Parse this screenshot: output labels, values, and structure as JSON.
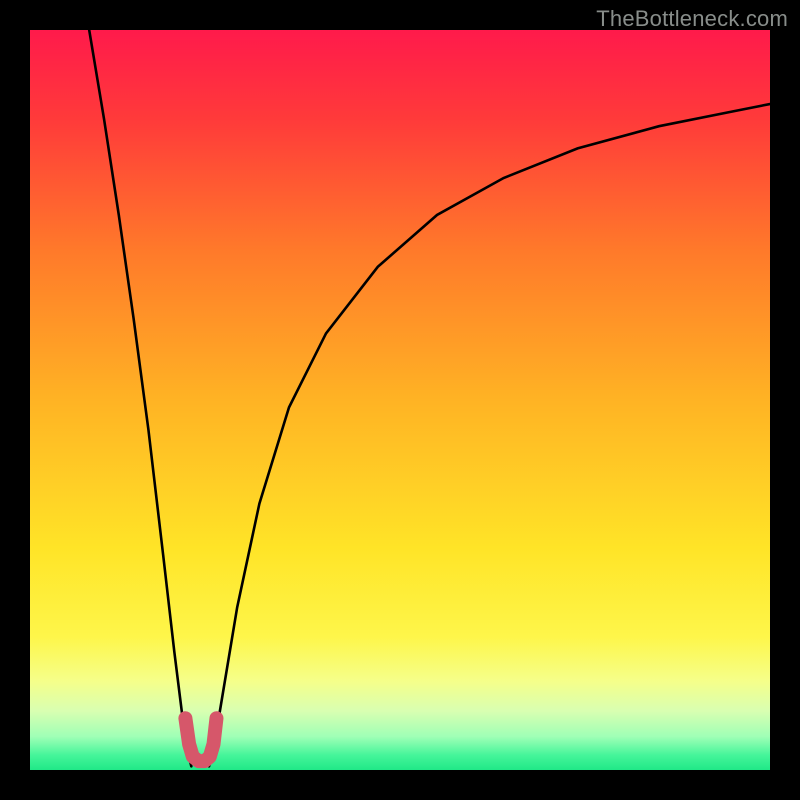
{
  "watermark": "TheBottleneck.com",
  "colors": {
    "frame": "#000000",
    "curve_stroke": "#000000",
    "marker_stroke": "#d6576a",
    "gradient_stops": [
      {
        "offset": 0.0,
        "color": "#ff1a4b"
      },
      {
        "offset": 0.12,
        "color": "#ff3a3a"
      },
      {
        "offset": 0.3,
        "color": "#ff7a2a"
      },
      {
        "offset": 0.5,
        "color": "#ffb324"
      },
      {
        "offset": 0.7,
        "color": "#ffe427"
      },
      {
        "offset": 0.82,
        "color": "#fef64a"
      },
      {
        "offset": 0.88,
        "color": "#f5ff8a"
      },
      {
        "offset": 0.92,
        "color": "#d9ffb1"
      },
      {
        "offset": 0.955,
        "color": "#9fffb6"
      },
      {
        "offset": 0.98,
        "color": "#45f59a"
      },
      {
        "offset": 1.0,
        "color": "#20e887"
      }
    ]
  },
  "chart_data": {
    "type": "line",
    "title": "",
    "xlabel": "",
    "ylabel": "",
    "xlim": [
      0,
      100
    ],
    "ylim": [
      0,
      100
    ],
    "series": [
      {
        "name": "left-branch",
        "x": [
          8,
          10,
          12,
          14,
          16,
          18,
          19.5,
          20.5,
          21.2,
          21.8
        ],
        "y": [
          100,
          88,
          75,
          61,
          46,
          29,
          16,
          8,
          3,
          0.5
        ]
      },
      {
        "name": "right-branch",
        "x": [
          24.2,
          25,
          26,
          28,
          31,
          35,
          40,
          47,
          55,
          64,
          74,
          85,
          95,
          100
        ],
        "y": [
          0.5,
          4,
          10,
          22,
          36,
          49,
          59,
          68,
          75,
          80,
          84,
          87,
          89,
          90
        ]
      }
    ],
    "marker": {
      "name": "u-marker",
      "x": [
        21.0,
        21.5,
        22.0,
        22.8,
        23.6,
        24.3,
        24.8,
        25.2
      ],
      "y": [
        7.0,
        3.5,
        1.8,
        1.2,
        1.2,
        1.8,
        3.5,
        7.0
      ]
    }
  }
}
